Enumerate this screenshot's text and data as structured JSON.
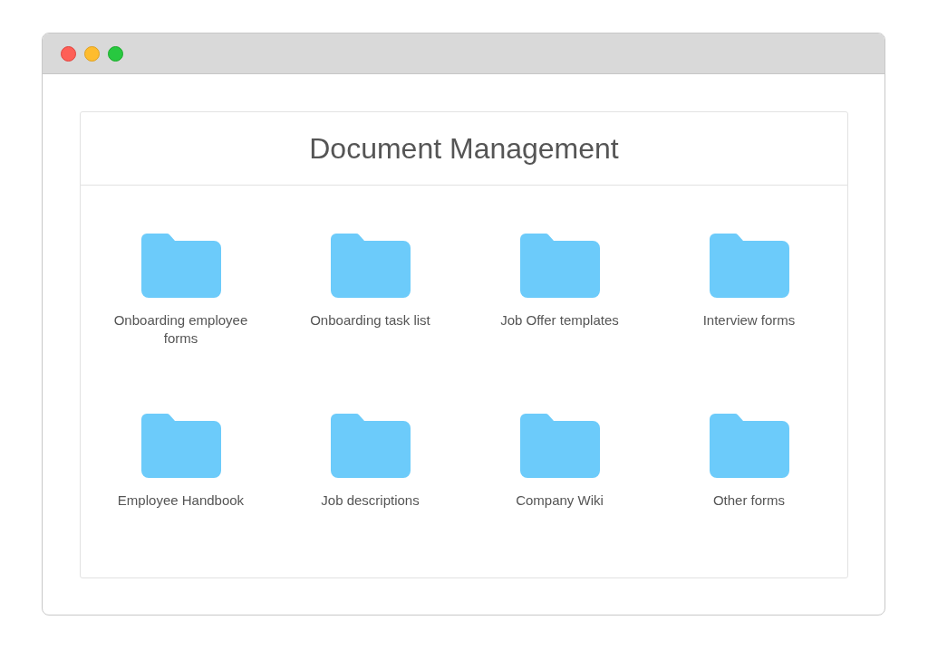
{
  "title": "Document Management",
  "folders": [
    {
      "label": "Onboarding employee forms"
    },
    {
      "label": "Onboarding task list"
    },
    {
      "label": "Job Offer templates"
    },
    {
      "label": "Interview forms"
    },
    {
      "label": "Employee Handbook"
    },
    {
      "label": "Job descriptions"
    },
    {
      "label": "Company Wiki"
    },
    {
      "label": "Other forms"
    }
  ]
}
